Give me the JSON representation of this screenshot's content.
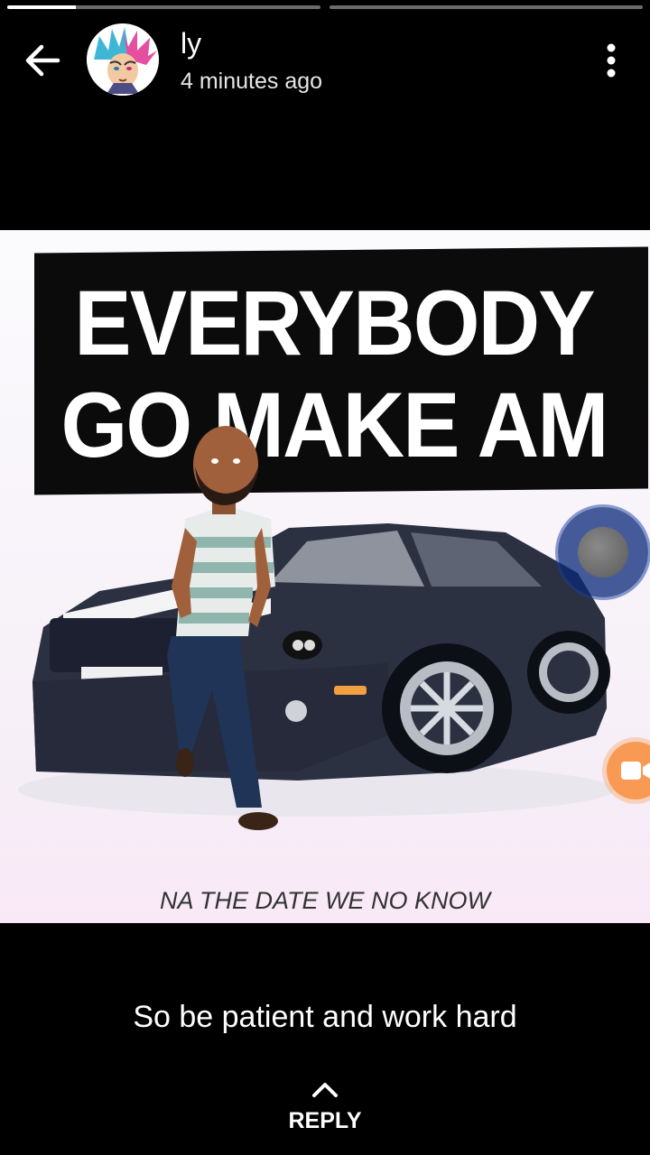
{
  "status": {
    "segments": [
      {
        "progress": 0.22
      },
      {
        "progress": 0
      }
    ]
  },
  "header": {
    "user_name": "ly",
    "timestamp": "4 minutes ago",
    "back_icon": "arrow-left-icon",
    "menu_icon": "more-vertical-icon",
    "avatar_icon": "anime-avatar"
  },
  "media": {
    "headline_line1": "EVERYBODY",
    "headline_line2": "GO MAKE AM",
    "footer_caption": "NA THE DATE WE NO KNOW",
    "background_color": "#f7f1f8",
    "banner_color": "#0b0b0b",
    "car_color": "#2c3142"
  },
  "overlays": {
    "bubble_color": "#0a2878",
    "video_fab_color": "#f89a54",
    "video_icon": "video-camera-icon"
  },
  "caption": "So be patient and work hard",
  "reply": {
    "label": "REPLY",
    "icon": "chevron-up-icon"
  }
}
